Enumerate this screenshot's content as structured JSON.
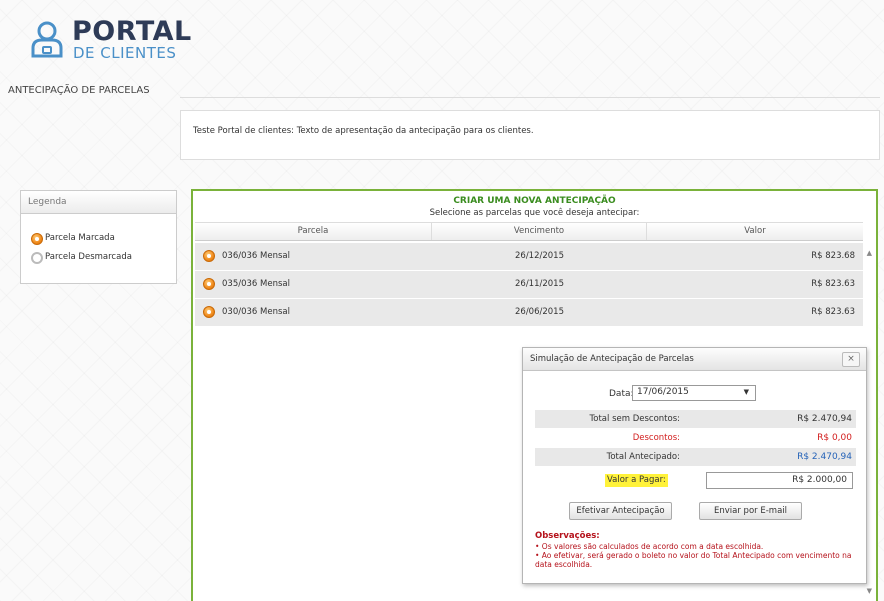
{
  "brand": {
    "title": "PORTAL",
    "subtitle": "DE CLIENTES"
  },
  "page_heading": "ANTECIPAÇÃO DE PARCELAS",
  "intro_text": "Teste Portal de clientes: Texto de apresentação da antecipação para os clientes.",
  "legend": {
    "title": "Legenda",
    "items": [
      {
        "label": "Parcela Marcada",
        "icon": "checked-radio-icon"
      },
      {
        "label": "Parcela Desmarcada",
        "icon": "unchecked-radio-icon"
      }
    ]
  },
  "main": {
    "title": "CRIAR UMA NOVA ANTECIPAÇÃO",
    "subtitle": "Selecione as parcelas que você deseja antecipar:",
    "columns": [
      "Parcela",
      "Vencimento",
      "Valor"
    ],
    "rows": [
      {
        "parcela": "036/036 Mensal",
        "vencimento": "26/12/2015",
        "valor": "R$ 823.68"
      },
      {
        "parcela": "035/036 Mensal",
        "vencimento": "26/11/2015",
        "valor": "R$ 823.63"
      },
      {
        "parcela": "030/036 Mensal",
        "vencimento": "26/06/2015",
        "valor": "R$ 823.63"
      }
    ]
  },
  "dialog": {
    "title": "Simulação de Antecipação de Parcelas",
    "close": "×",
    "date_label": "Data:",
    "date_value": "17/06/2015",
    "rows": [
      {
        "label": "Total sem Descontos:",
        "value": "R$ 2.470,94"
      },
      {
        "label": "Descontos:",
        "value": "R$ 0,00"
      },
      {
        "label": "Total Antecipado:",
        "value": "R$ 2.470,94"
      }
    ],
    "pay_label": "Valor a Pagar:",
    "pay_value": "R$ 2.000,00",
    "btn_confirm": "Efetivar Antecipação",
    "btn_email": "Enviar por E-mail",
    "obs_title": "Observações:",
    "obs_lines": [
      "• Os valores são calculados de acordo com a data escolhida.",
      "• Ao efetivar, será gerado o boleto no valor do Total Antecipado com vencimento na data escolhida."
    ]
  },
  "colors": {
    "accent_green": "#7ab23a",
    "title_green": "#3a8c1f",
    "highlight": "#fff23a",
    "discount_red": "#d21d1d",
    "total_blue": "#2563b8"
  }
}
